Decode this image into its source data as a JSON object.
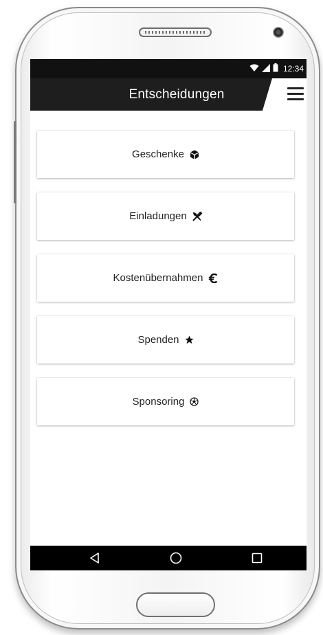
{
  "status_bar": {
    "time": "12:34",
    "icons": [
      "wifi-icon",
      "signal-icon",
      "battery-icon"
    ]
  },
  "app_bar": {
    "title": "Entscheidungen",
    "menu_icon": "hamburger-menu-icon"
  },
  "menu": {
    "items": [
      {
        "label": "Geschenke",
        "icon": "cube-icon"
      },
      {
        "label": "Einladungen",
        "icon": "cutlery-icon"
      },
      {
        "label": "Kostenübernahmen",
        "icon": "euro-icon"
      },
      {
        "label": "Spenden",
        "icon": "star-icon"
      },
      {
        "label": "Sponsoring",
        "icon": "soccer-ball-icon"
      }
    ]
  },
  "nav_bar": {
    "buttons": [
      "back-icon",
      "home-icon",
      "recents-icon"
    ]
  },
  "colors": {
    "app_bar_background": "#1e1e1e",
    "status_bar_background": "#111111",
    "nav_bar_background": "#000000",
    "card_background": "#ffffff",
    "text": "#222222"
  }
}
